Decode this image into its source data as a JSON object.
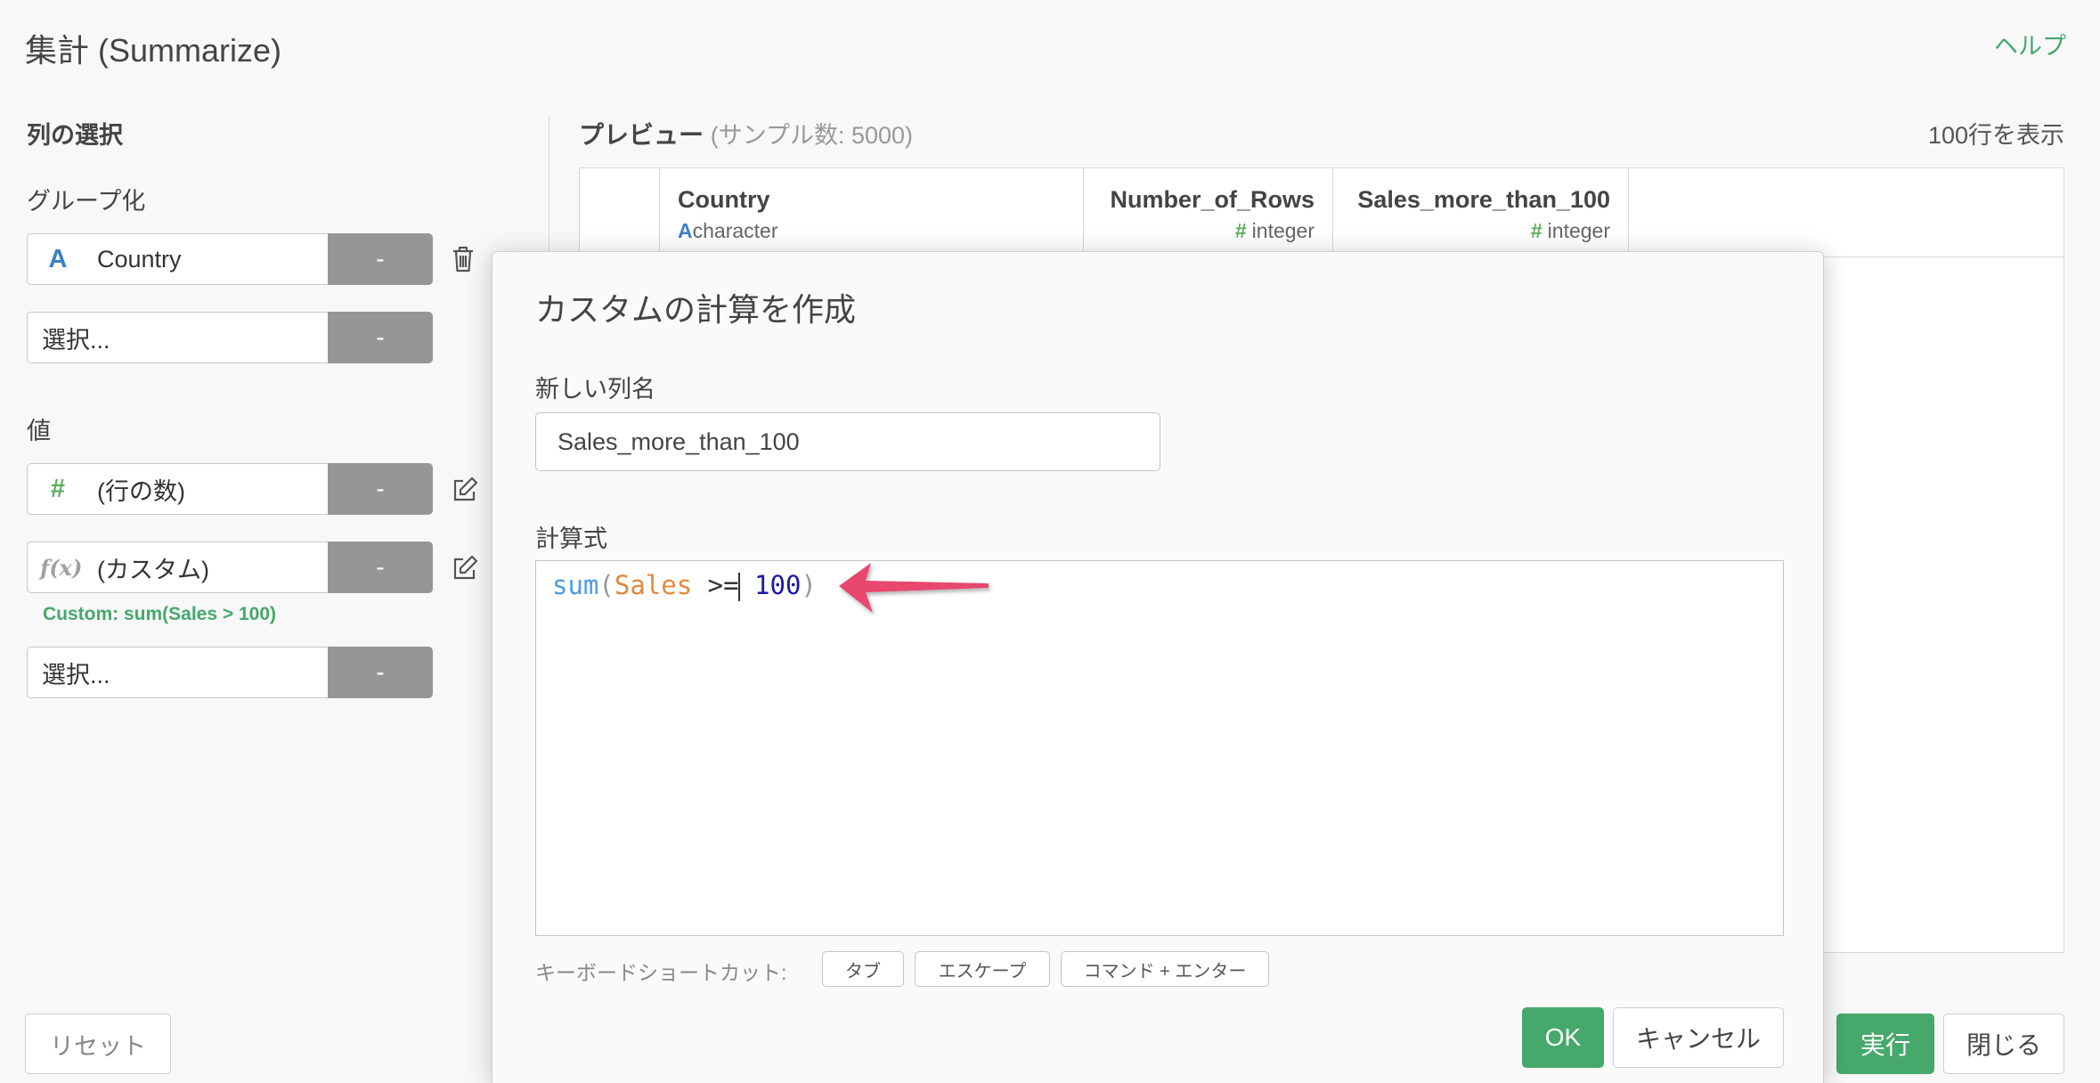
{
  "header": {
    "title": "集計 (Summarize)",
    "help_label": "ヘルプ"
  },
  "left_panel": {
    "column_select_heading": "列の選択",
    "group_heading": "グループ化",
    "group_rows": [
      {
        "type_icon": "A",
        "value": "Country",
        "btn": "-"
      },
      {
        "placeholder": "選択...",
        "btn": "-"
      }
    ],
    "value_heading": "値",
    "value_rows": [
      {
        "type_icon": "#",
        "value": "(行の数)",
        "btn": "-"
      },
      {
        "type_icon": "f(x)",
        "value": "(カスタム)",
        "btn": "-",
        "note": "Custom: sum(Sales > 100)"
      },
      {
        "placeholder": "選択...",
        "btn": "-"
      }
    ],
    "reset_label": "リセット"
  },
  "preview": {
    "title": "プレビュー",
    "sample_text": "(サンプル数: 5000)",
    "rows_display": "100行を表示",
    "columns": [
      {
        "name": "Country",
        "type_icon": "A",
        "type": "character"
      },
      {
        "name": "Number_of_Rows",
        "type_icon": "#",
        "type": "integer"
      },
      {
        "name": "Sales_more_than_100",
        "type_icon": "#",
        "type": "integer"
      }
    ]
  },
  "modal": {
    "title": "カスタムの計算を作成",
    "new_column_label": "新しい列名",
    "new_column_value": "Sales_more_than_100",
    "formula_label": "計算式",
    "formula_tokens": {
      "fn": "sum",
      "open": "(",
      "col": "Sales",
      "op": ">=",
      "num": "100",
      "close": ")"
    },
    "shortcut_label": "キーボードショートカット:",
    "shortcuts": [
      "タブ",
      "エスケープ",
      "コマンド + エンター"
    ],
    "ok_label": "OK",
    "cancel_label": "キャンセル"
  },
  "footer": {
    "run_label": "実行",
    "close_label": "閉じる"
  },
  "colors": {
    "accent_green": "#46a86b",
    "arrow_pink": "#e8466e",
    "char_blue": "#3c80c6",
    "num_green": "#5aab5c"
  },
  "icons": {
    "trash": "trash-icon",
    "edit": "edit-icon",
    "arrow": "arrow-annotation-icon"
  }
}
